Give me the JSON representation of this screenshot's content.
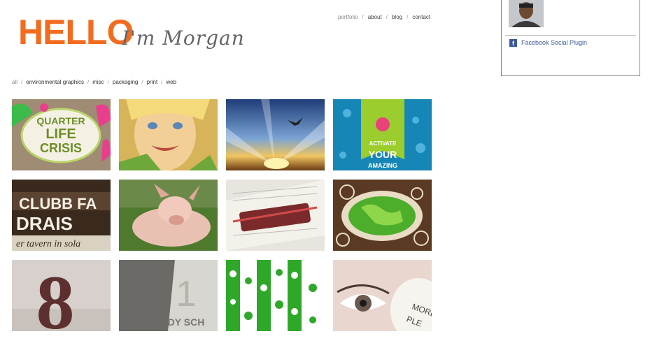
{
  "logo": {
    "hello": "HELLO",
    "script": "I'm Morgan",
    "color": "#f26c1f"
  },
  "topnav": {
    "items": [
      "portfolio",
      "about",
      "blog",
      "contact"
    ]
  },
  "filters": {
    "items": [
      "all",
      "environmental graphics",
      "misc",
      "packaging",
      "print",
      "web"
    ]
  },
  "tiles": [
    {
      "name": "quarter-life-crisis",
      "text": [
        "QUARTER",
        "LIFE",
        "CRISIS"
      ]
    },
    {
      "name": "smiling-girl"
    },
    {
      "name": "sunset-sky"
    },
    {
      "name": "activate-your-amazing",
      "text": [
        "ACTIVATE",
        "YOUR",
        "AMAZING"
      ]
    },
    {
      "name": "clubb-fundraiser",
      "text": [
        "CLUBB FA",
        "DRAIS",
        "er tavern in sola"
      ]
    },
    {
      "name": "pig-on-grass"
    },
    {
      "name": "wedding-invitation"
    },
    {
      "name": "green-globe"
    },
    {
      "name": "number-8-sign",
      "text": [
        "8"
      ]
    },
    {
      "name": "number-1-sign",
      "text": [
        "1",
        "DY SCH"
      ]
    },
    {
      "name": "green-pattern"
    },
    {
      "name": "eye-with-mug",
      "text": [
        "MORE",
        "PLE"
      ]
    }
  ],
  "facebook": {
    "plugin_label": "Facebook Social Plugin",
    "icon_glyph": "f"
  }
}
